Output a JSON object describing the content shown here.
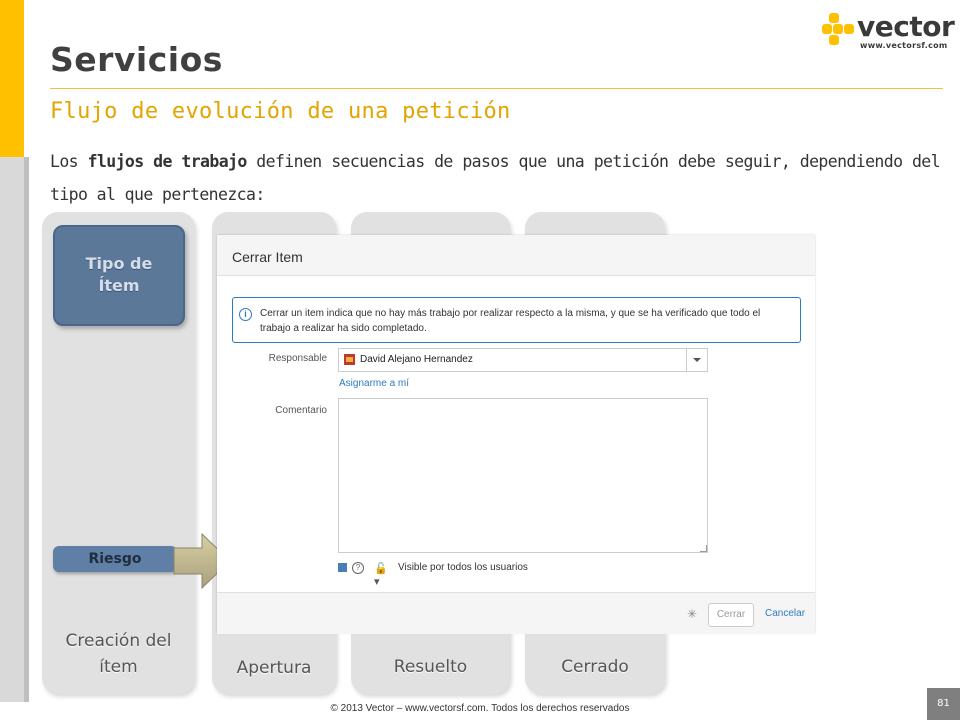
{
  "slide": {
    "title": "Servicios",
    "subtitle": "Flujo de evolución de una petición",
    "paragraph": {
      "part1": "Los ",
      "bold": "flujos de trabajo",
      "part2": " definen secuencias de pasos que una petición debe seguir, dependiendo del tipo al que pertenezca:"
    }
  },
  "logo": {
    "word": "vector",
    "url": "www.vectorsf.com",
    "color": "#ffc000"
  },
  "workflow": {
    "type_box": {
      "line1": "Tipo de",
      "line2": "Ítem"
    },
    "risk": "Riesgo",
    "columns": [
      {
        "label_line1": "Creación del",
        "label_line2": "ítem"
      },
      {
        "label_line1": "Apertura"
      },
      {
        "label_line1": "Resuelto"
      },
      {
        "label_line1": "Cerrado"
      }
    ]
  },
  "dialog": {
    "title": "Cerrar Item",
    "info": "Cerrar un item indica que no hay más trabajo por realizar respecto a la misma, y que se ha verificado que todo el trabajo a realizar ha sido completado.",
    "info_icon": "i",
    "responsible_label": "Responsable",
    "responsible_value": "David Alejano Hernandez",
    "assign_link": "Asignarme a mí",
    "comment_label": "Comentario",
    "comment_value": "",
    "visibility": "Visible por todos los usuarios",
    "help_glyph": "?",
    "close_button": "Cerrar",
    "cancel_link": "Cancelar"
  },
  "footer": {
    "copyright": "© 2013 Vector – www.vectorsf.com. Todos los derechos reservados",
    "page_number": "81"
  },
  "colors": {
    "accent_yellow": "#ffc000",
    "title_grey": "#404040",
    "subtitle_orange": "#e3a400",
    "link_blue": "#2d7bbf",
    "type_box_blue": "#5b7899"
  }
}
